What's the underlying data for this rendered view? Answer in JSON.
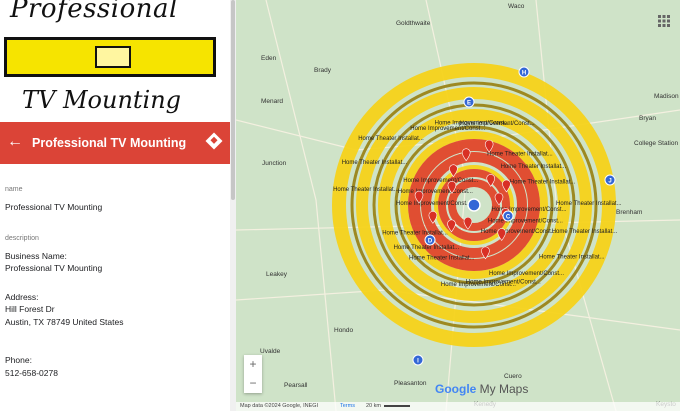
{
  "logo": {
    "line1": "Professional",
    "line2": "TV Mounting"
  },
  "header": {
    "title": "Professional TV Mounting",
    "back_icon": "arrow-left-icon",
    "directions_icon": "directions-icon"
  },
  "fields": {
    "name_label": "name",
    "name_value": "Professional TV Mounting",
    "description_label": "description",
    "desc_line1": "Business Name:",
    "desc_line2": "Professional TV Mounting",
    "address_heading": "Address:",
    "address_line1": "Hill Forest Dr",
    "address_line2": "Austin, TX 78749 United States",
    "phone_heading": "Phone:",
    "phone_value": "512-658-0278"
  },
  "map": {
    "towns": [
      "Goldthwaite",
      "Waco",
      "Eden",
      "Brady",
      "Menard",
      "Junction",
      "Leakey",
      "Hondo",
      "Uvalde",
      "Pearsall",
      "Pleasanton",
      "Kenedy",
      "Cuero",
      "Madison",
      "Bryan",
      "College Station",
      "Brenham",
      "Keysto"
    ],
    "ring_labels": [
      "Home Theater Installat...",
      "Home Improvement/Const...",
      "Home Theater Installat...",
      "Home Improvement/Const...",
      "Home Theater Installat...",
      "Home Improvement/Const...",
      "Home Theater Installat...",
      "Home Improvement/Const...",
      "Home Theater Installat...",
      "Home Improvement/Const...",
      "Home Theater Installat...",
      "Home Improvement/Const...",
      "Home Theater Installat...",
      "Home Improvement/Const...",
      "Home Theater Installat...",
      "Home Improvement/Const...",
      "Home Theater Installat...",
      "Home Improvement/Const...",
      "Home Theater Installat...",
      "Home Improvement/Const...",
      "Home Theater Installat...",
      "Home Improvement/Const...",
      "Home Theater Installat...",
      "Home Improvement/Const..."
    ],
    "markers": [
      "H",
      "E",
      "C",
      "D",
      "J",
      "I"
    ],
    "brand_google": "Google",
    "brand_mymaps": " My Maps",
    "attribution": "Map data ©2024 Google, INEGI",
    "terms": "Terms",
    "scale": "20 km",
    "zoom_in": "+",
    "zoom_out": "−",
    "colors": {
      "outer_ring": "#f6d21a",
      "dark_ring": "#9a8418",
      "inner_ring": "#e0462a",
      "marker": "#3367d6",
      "land": "#cfe3c8"
    }
  }
}
